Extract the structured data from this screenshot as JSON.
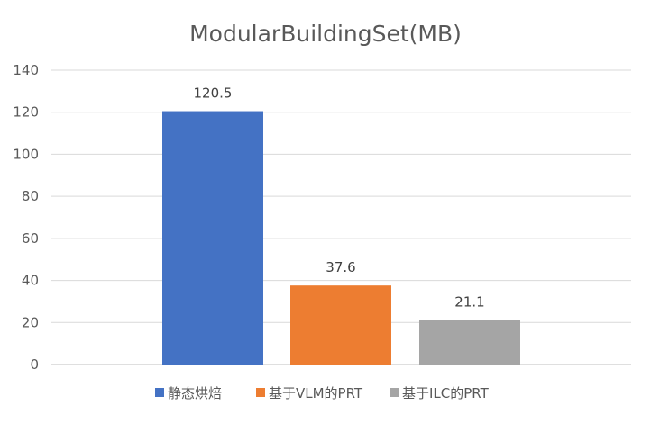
{
  "chart_data": {
    "type": "bar",
    "title": "ModularBuildingSet(MB)",
    "xlabel": "",
    "ylabel": "",
    "ylim": [
      0,
      140
    ],
    "yticks": [
      0,
      20,
      40,
      60,
      80,
      100,
      120,
      140
    ],
    "ytick_labels": [
      "0",
      "20",
      "40",
      "60",
      "80",
      "100",
      "120",
      "140"
    ],
    "grid": true,
    "legend_position": "bottom",
    "series": [
      {
        "name": "静态烘焙",
        "value": 120.5,
        "label": "120.5",
        "color": "#4472c4"
      },
      {
        "name": "基于VLM的PRT",
        "value": 37.6,
        "label": "37.6",
        "color": "#ed7d31"
      },
      {
        "name": "基于ILC的PRT",
        "value": 21.1,
        "label": "21.1",
        "color": "#a5a5a5"
      }
    ]
  }
}
